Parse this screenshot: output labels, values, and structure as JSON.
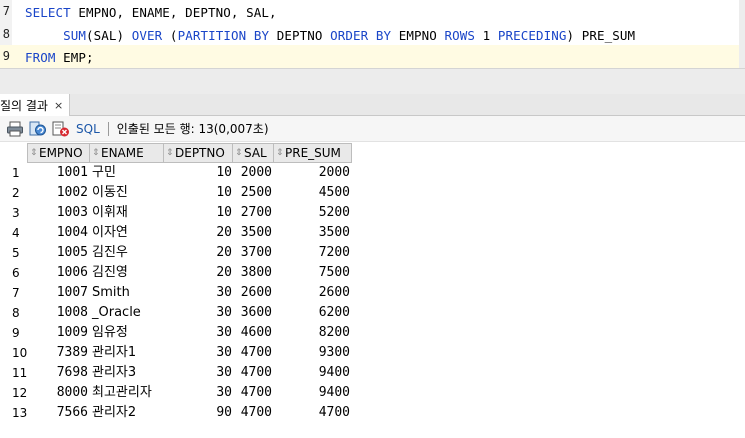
{
  "editor": {
    "lines": [
      {
        "no": "7",
        "segments": [
          {
            "t": "SELECT ",
            "k": true
          },
          {
            "t": "EMPNO, ENAME, DEPTNO, SAL,",
            "k": false
          }
        ]
      },
      {
        "no": "8",
        "segments": [
          {
            "t": "     SUM",
            "k": true
          },
          {
            "t": "(SAL) ",
            "k": false
          },
          {
            "t": "OVER ",
            "k": true
          },
          {
            "t": "(",
            "k": false
          },
          {
            "t": "PARTITION BY ",
            "k": true
          },
          {
            "t": "DEPTNO ",
            "k": false
          },
          {
            "t": "ORDER BY ",
            "k": true
          },
          {
            "t": "EMPNO ",
            "k": false
          },
          {
            "t": "ROWS ",
            "k": true
          },
          {
            "t": "1 ",
            "k": false
          },
          {
            "t": "PRECEDING",
            "k": true
          },
          {
            "t": ") PRE_SUM",
            "k": false
          }
        ]
      },
      {
        "no": "9",
        "segments": [
          {
            "t": "FROM ",
            "k": true
          },
          {
            "t": "EMP;",
            "k": false
          }
        ]
      }
    ]
  },
  "results_tab": {
    "label": "질의 결과",
    "close": "×"
  },
  "toolbar": {
    "sql_label": "SQL",
    "status": "인출된 모든 행: 13(0,007초)"
  },
  "grid": {
    "columns": [
      "EMPNO",
      "ENAME",
      "DEPTNO",
      "SAL",
      "PRE_SUM"
    ],
    "rows": [
      [
        "1",
        "1001",
        "구민",
        "10",
        "2000",
        "2000"
      ],
      [
        "2",
        "1002",
        "이동진",
        "10",
        "2500",
        "4500"
      ],
      [
        "3",
        "1003",
        "이휘재",
        "10",
        "2700",
        "5200"
      ],
      [
        "4",
        "1004",
        "이자연",
        "20",
        "3500",
        "3500"
      ],
      [
        "5",
        "1005",
        "김진우",
        "20",
        "3700",
        "7200"
      ],
      [
        "6",
        "1006",
        "김진영",
        "20",
        "3800",
        "7500"
      ],
      [
        "7",
        "1007",
        "Smith",
        "30",
        "2600",
        "2600"
      ],
      [
        "8",
        "1008",
        "_Oracle",
        "30",
        "3600",
        "6200"
      ],
      [
        "9",
        "1009",
        "임유정",
        "30",
        "4600",
        "8200"
      ],
      [
        "10",
        "7389",
        "관리자1",
        "30",
        "4700",
        "9300"
      ],
      [
        "11",
        "7698",
        "관리자3",
        "30",
        "4700",
        "9400"
      ],
      [
        "12",
        "8000",
        "최고관리자",
        "30",
        "4700",
        "9400"
      ],
      [
        "13",
        "7566",
        "관리자2",
        "90",
        "4700",
        "4700"
      ]
    ]
  },
  "colors": {
    "keyword": "#1a45c8",
    "current_line": "#fffbe3"
  }
}
